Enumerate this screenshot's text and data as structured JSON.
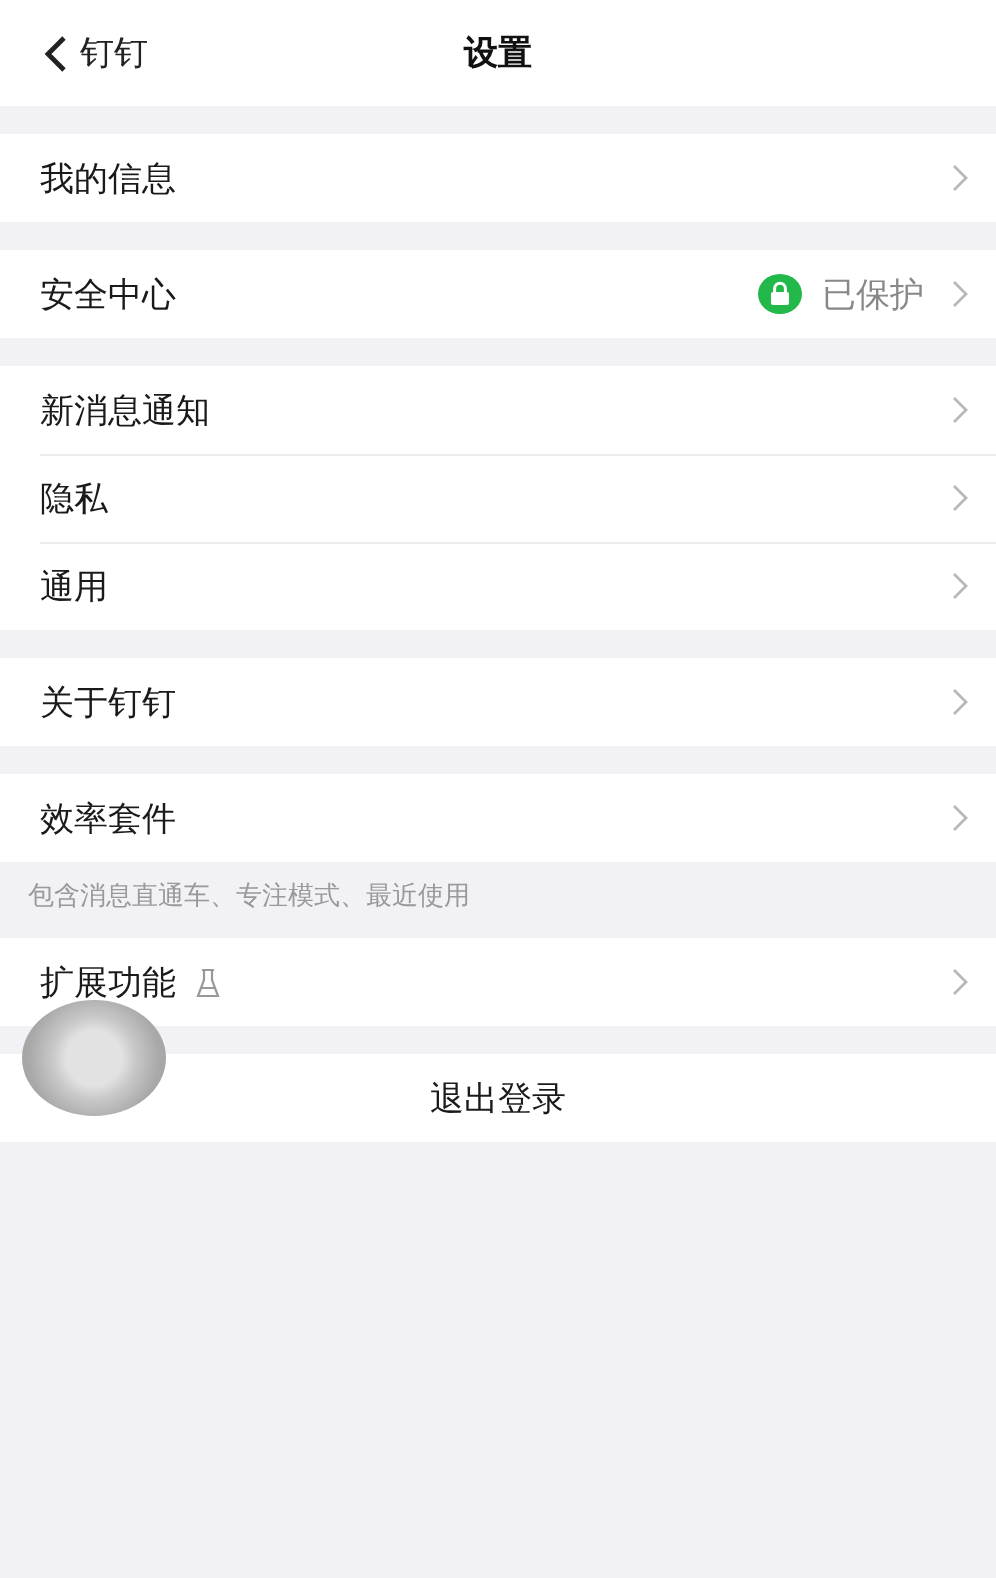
{
  "nav": {
    "back_label": "钉钉",
    "title": "设置"
  },
  "groups": [
    {
      "rows": [
        {
          "label": "我的信息",
          "kind": "plain"
        }
      ]
    },
    {
      "rows": [
        {
          "label": "安全中心",
          "kind": "status",
          "status": "已保护"
        }
      ]
    },
    {
      "rows": [
        {
          "label": "新消息通知",
          "kind": "plain"
        },
        {
          "label": "隐私",
          "kind": "plain"
        },
        {
          "label": "通用",
          "kind": "plain"
        }
      ]
    },
    {
      "rows": [
        {
          "label": "关于钉钉",
          "kind": "plain"
        }
      ]
    },
    {
      "rows": [
        {
          "label": "效率套件",
          "kind": "plain"
        }
      ],
      "footnote": "包含消息直通车、专注模式、最近使用"
    },
    {
      "rows": [
        {
          "label": "扩展功能",
          "kind": "lab"
        }
      ]
    }
  ],
  "logout": "退出登录"
}
